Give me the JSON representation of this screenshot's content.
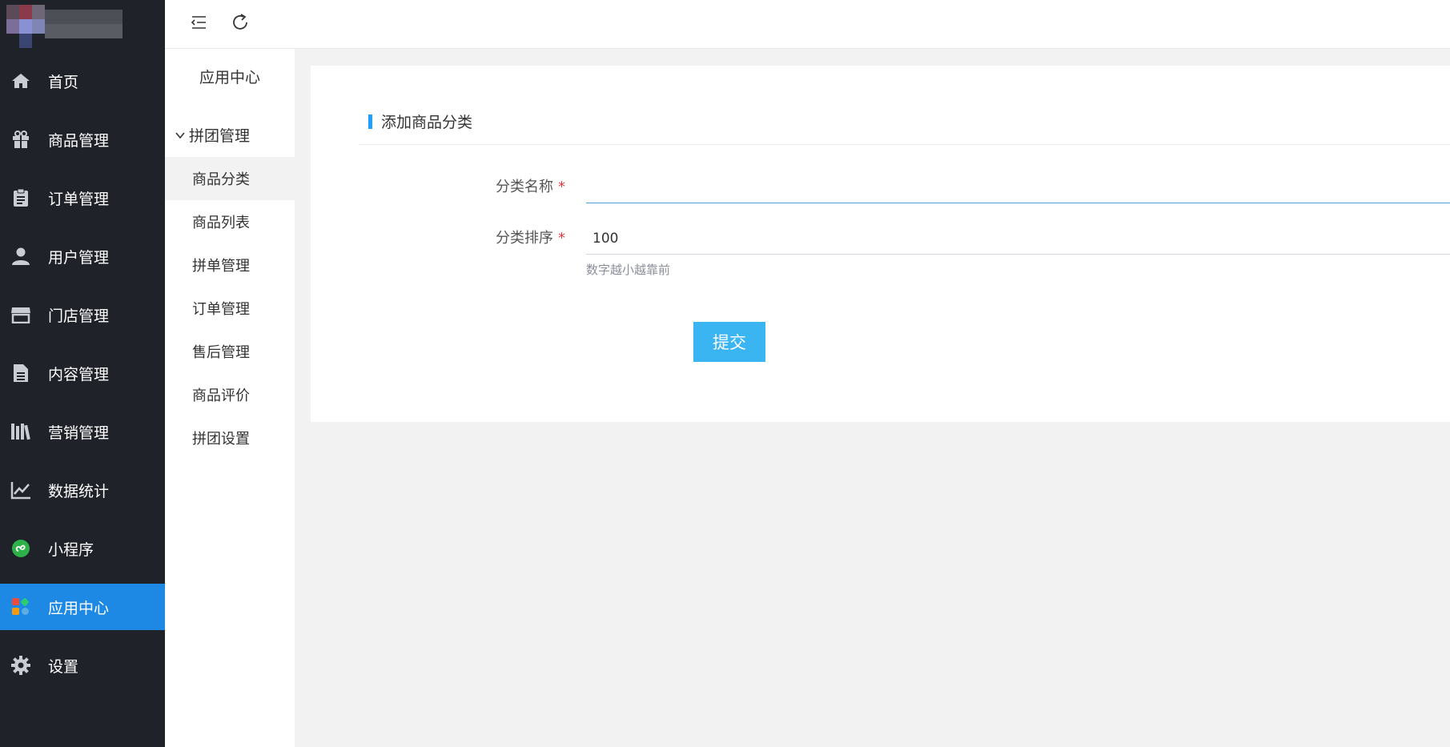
{
  "sidebar": {
    "items": [
      {
        "label": "首页",
        "icon": "home-icon"
      },
      {
        "label": "商品管理",
        "icon": "gift-icon"
      },
      {
        "label": "订单管理",
        "icon": "clipboard-icon"
      },
      {
        "label": "用户管理",
        "icon": "user-icon"
      },
      {
        "label": "门店管理",
        "icon": "store-icon"
      },
      {
        "label": "内容管理",
        "icon": "document-icon"
      },
      {
        "label": "营销管理",
        "icon": "books-icon"
      },
      {
        "label": "数据统计",
        "icon": "line-chart-icon"
      },
      {
        "label": "小程序",
        "icon": "mini-program-icon"
      },
      {
        "label": "应用中心",
        "icon": "apps-icon",
        "active": true
      },
      {
        "label": "设置",
        "icon": "gear-icon"
      }
    ],
    "active_color": "#1e88e5",
    "bg_color": "#20222a"
  },
  "subnav": {
    "header": "应用中心",
    "group": "拼团管理",
    "items": [
      {
        "label": "商品分类",
        "active": true
      },
      {
        "label": "商品列表"
      },
      {
        "label": "拼单管理"
      },
      {
        "label": "订单管理"
      },
      {
        "label": "售后管理"
      },
      {
        "label": "商品评价"
      },
      {
        "label": "拼团设置"
      }
    ]
  },
  "topbar": {
    "icons": [
      "collapse-menu-icon",
      "refresh-icon"
    ]
  },
  "form": {
    "title": "添加商品分类",
    "fields": [
      {
        "label": "分类名称",
        "required_mark": "*",
        "value": ""
      },
      {
        "label": "分类排序",
        "required_mark": "*",
        "value": "100",
        "hint": "数字越小越靠前"
      }
    ],
    "submit_label": "提交",
    "accent_color": "#3bb4f2"
  }
}
